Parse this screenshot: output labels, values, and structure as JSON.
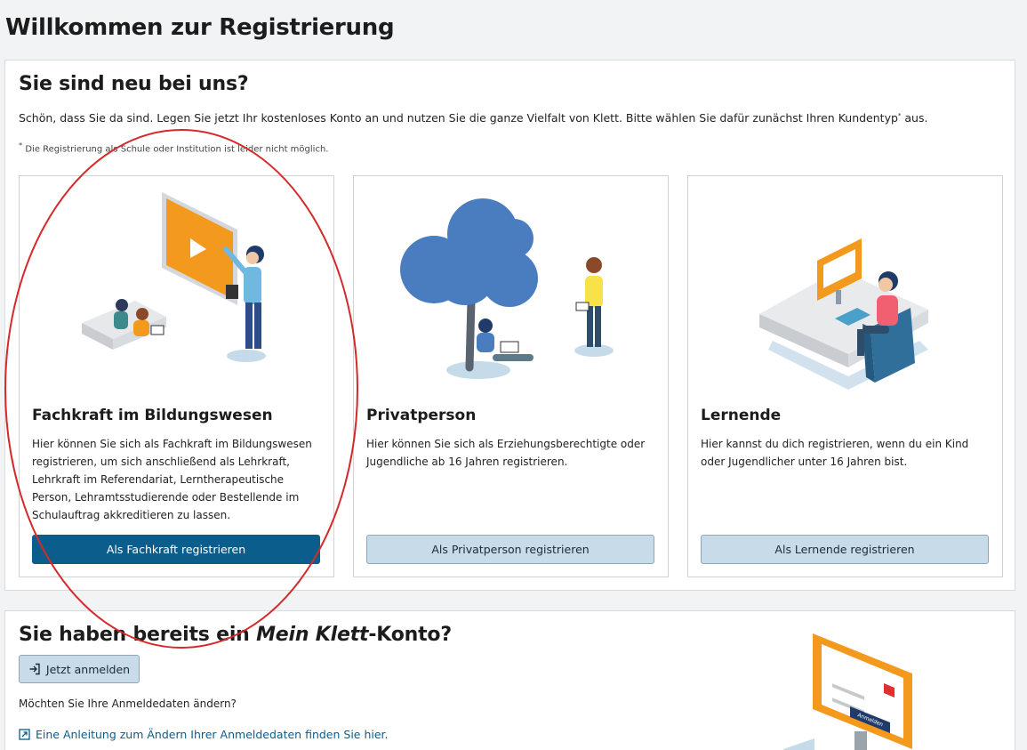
{
  "page": {
    "title": "Willkommen zur Registrierung"
  },
  "register": {
    "heading": "Sie sind neu bei uns?",
    "intro": "Schön, dass Sie da sind. Legen Sie jetzt Ihr kostenloses Konto an und nutzen Sie die ganze Vielfalt von Klett. Bitte wählen Sie dafür zunächst Ihren Kundentyp",
    "intro_mark": "*",
    "intro_end": " aus.",
    "footnote_mark": "*",
    "footnote": " Die Registrierung als Schule oder Institution ist leider nicht möglich.",
    "cards": [
      {
        "title": "Fachkraft im Bildungswesen",
        "text": "Hier können Sie sich als Fachkraft im Bildungswesen registrieren, um sich anschließend als Lehrkraft, Lehrkraft im Referendariat, Lerntherapeutische Person, Lehramtsstudierende oder Bestellende im Schulauftrag akkreditieren zu lassen.",
        "button": "Als Fachkraft registrieren"
      },
      {
        "title": "Privatperson",
        "text": "Hier können Sie sich als Erziehungsberechtigte oder Jugendliche ab 16 Jahren registrieren.",
        "button": "Als Privatperson registrieren"
      },
      {
        "title": "Lernende",
        "text": "Hier kannst du dich registrieren, wenn du ein Kind oder Jugendlicher unter 16 Jahren bist.",
        "button": "Als Lernende registrieren"
      }
    ]
  },
  "login": {
    "heading_pre": "Sie haben bereits ein ",
    "heading_em": "Mein Klett",
    "heading_post": "-Konto?",
    "button": "Jetzt anmelden",
    "question": "Möchten Sie Ihre Anmeldedaten ändern?",
    "link": "Eine Anleitung zum Ändern Ihrer Anmeldedaten finden Sie hier.",
    "illus_button": "Anmelden"
  },
  "colors": {
    "primary": "#0b5d8c",
    "secondary_btn": "#c7dbe8",
    "accent_orange": "#f39a1e",
    "tree_blue": "#4a7cc0",
    "annotation_red": "#d42a2a"
  },
  "icons": {
    "login": "login-arrow-icon",
    "external": "external-link-icon"
  }
}
